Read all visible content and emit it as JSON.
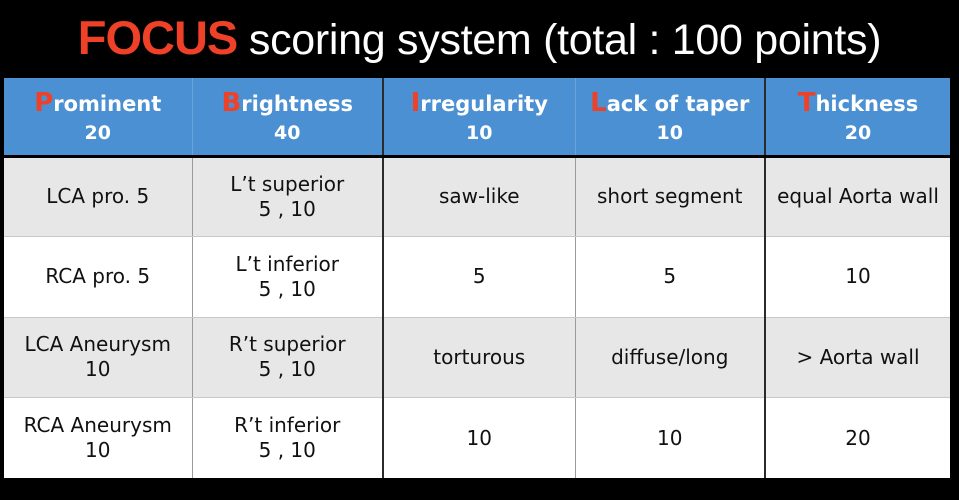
{
  "title": {
    "highlight": "FOCUS",
    "rest": " scoring system (total : 100 points)",
    "highlight_color": "#ee4128",
    "rest_color": "#ffffff"
  },
  "table": {
    "header_bg": "#4b90d2",
    "header_text_color": "#ffffff",
    "header_initial_color": "#ee4128",
    "row_shade_bg": "#e7e7e7",
    "row_plain_bg": "#ffffff",
    "columns": [
      {
        "initial": "P",
        "word": "rominent",
        "points": "20"
      },
      {
        "initial": "B",
        "word": "rightness",
        "points": "40"
      },
      {
        "initial": "I",
        "word": "rregularity",
        "points": "10"
      },
      {
        "initial": "L",
        "word": "ack of taper",
        "points": "10"
      },
      {
        "initial": "T",
        "word": "hickness",
        "points": "20"
      }
    ],
    "rows": [
      {
        "shaded": true,
        "cells": [
          {
            "line1": "LCA pro. 5",
            "line2": ""
          },
          {
            "line1": "L’t superior",
            "line2": "5 , 10"
          },
          {
            "line1": "saw-like",
            "line2": ""
          },
          {
            "line1": "short segment",
            "line2": ""
          },
          {
            "line1": "equal Aorta wall",
            "line2": ""
          }
        ]
      },
      {
        "shaded": false,
        "cells": [
          {
            "line1": "RCA pro. 5",
            "line2": ""
          },
          {
            "line1": "L’t inferior",
            "line2": "5 , 10"
          },
          {
            "line1": "5",
            "line2": ""
          },
          {
            "line1": "5",
            "line2": ""
          },
          {
            "line1": "10",
            "line2": ""
          }
        ]
      },
      {
        "shaded": true,
        "cells": [
          {
            "line1": "LCA Aneurysm",
            "line2": "10"
          },
          {
            "line1": "R’t superior",
            "line2": "5 , 10"
          },
          {
            "line1": "torturous",
            "line2": ""
          },
          {
            "line1": "diffuse/long",
            "line2": ""
          },
          {
            "line1": "> Aorta wall",
            "line2": ""
          }
        ]
      },
      {
        "shaded": false,
        "cells": [
          {
            "line1": "RCA Aneurysm",
            "line2": "10"
          },
          {
            "line1": "R’t inferior",
            "line2": "5 , 10"
          },
          {
            "line1": "10",
            "line2": ""
          },
          {
            "line1": "10",
            "line2": ""
          },
          {
            "line1": "20",
            "line2": ""
          }
        ]
      }
    ]
  }
}
